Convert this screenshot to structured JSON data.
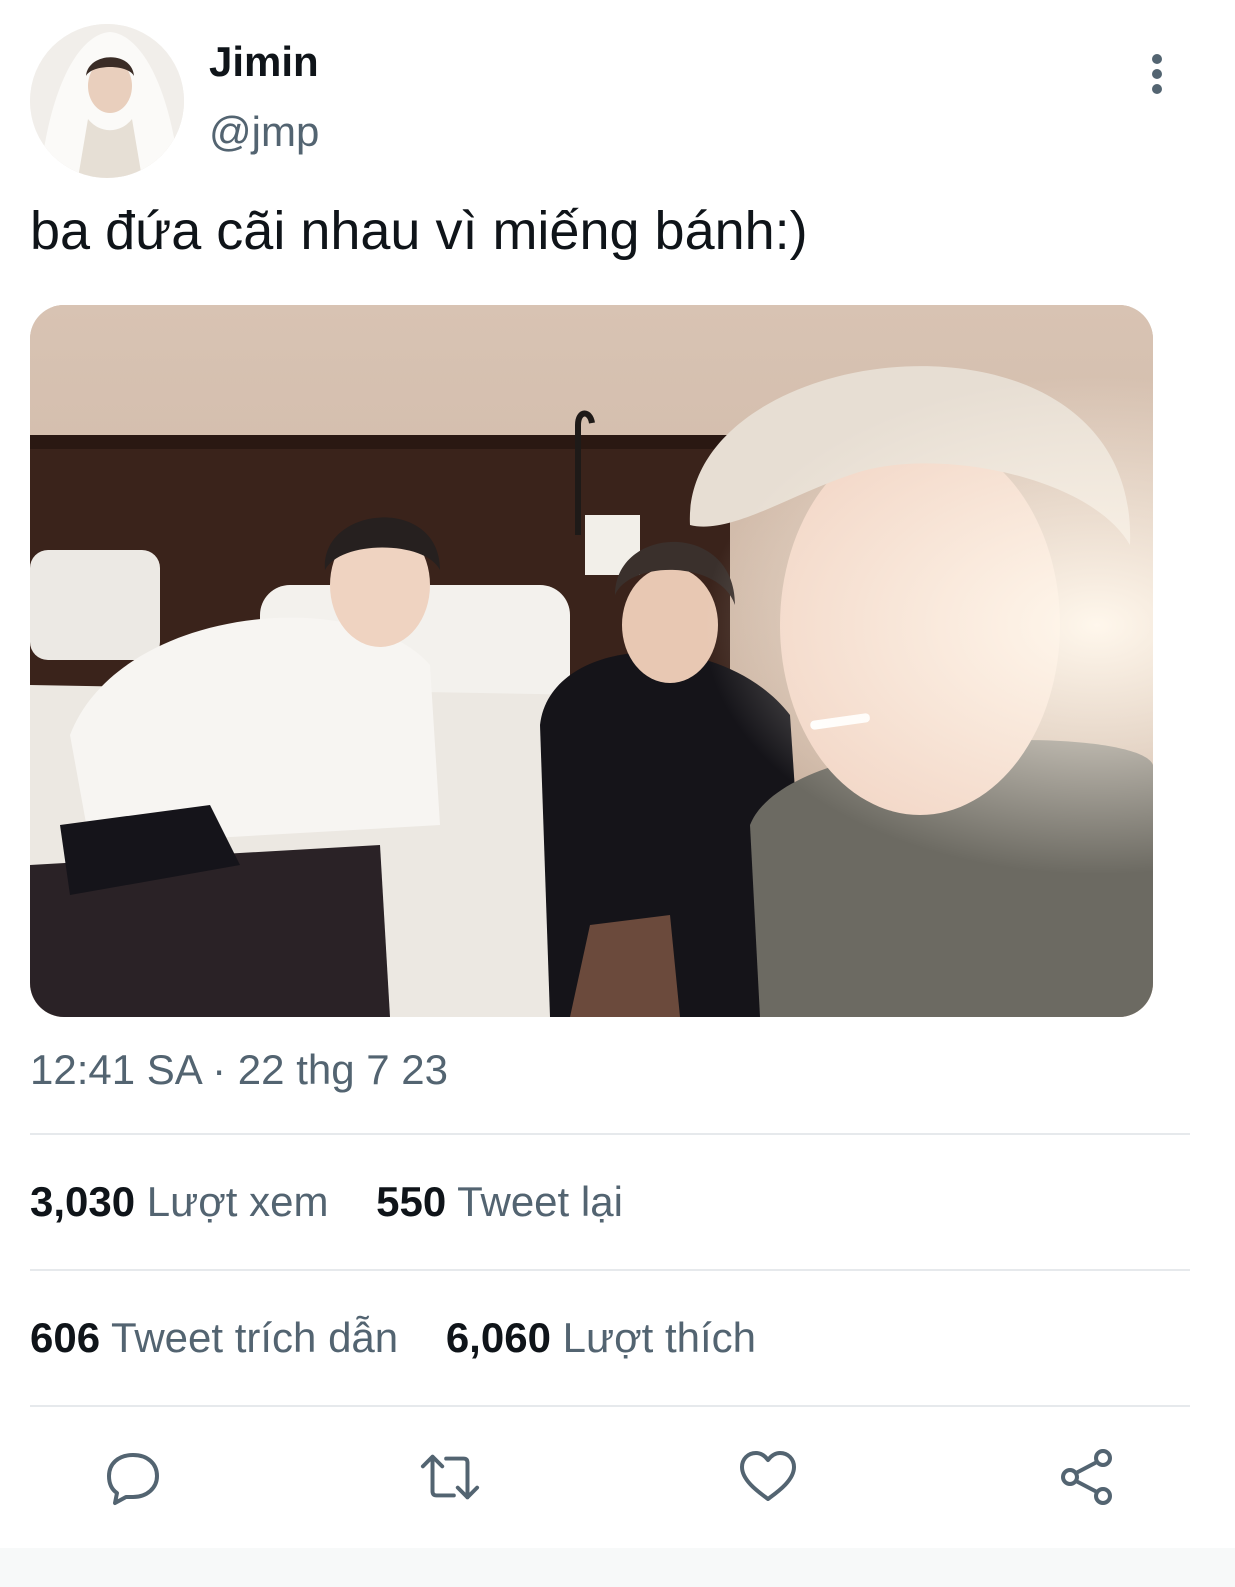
{
  "user": {
    "name": "Jimin",
    "handle": "@jmp"
  },
  "tweet": {
    "text": "ba đứa cãi nhau vì miếng bánh:)",
    "timestamp": "12:41 SA · 22 thg 7 23"
  },
  "stats": {
    "views_count": "3,030",
    "views_label": "Lượt xem",
    "retweets_count": "550",
    "retweets_label": "Tweet lại",
    "quotes_count": "606",
    "quotes_label": "Tweet trích dẫn",
    "likes_count": "6,060",
    "likes_label": "Lượt thích"
  },
  "icons": {
    "more": "more-vertical-icon",
    "reply": "reply-icon",
    "retweet": "retweet-icon",
    "like": "heart-icon",
    "share": "share-icon"
  },
  "colors": {
    "text_primary": "#0f1419",
    "text_secondary": "#536471",
    "divider": "#e6e9ec"
  }
}
